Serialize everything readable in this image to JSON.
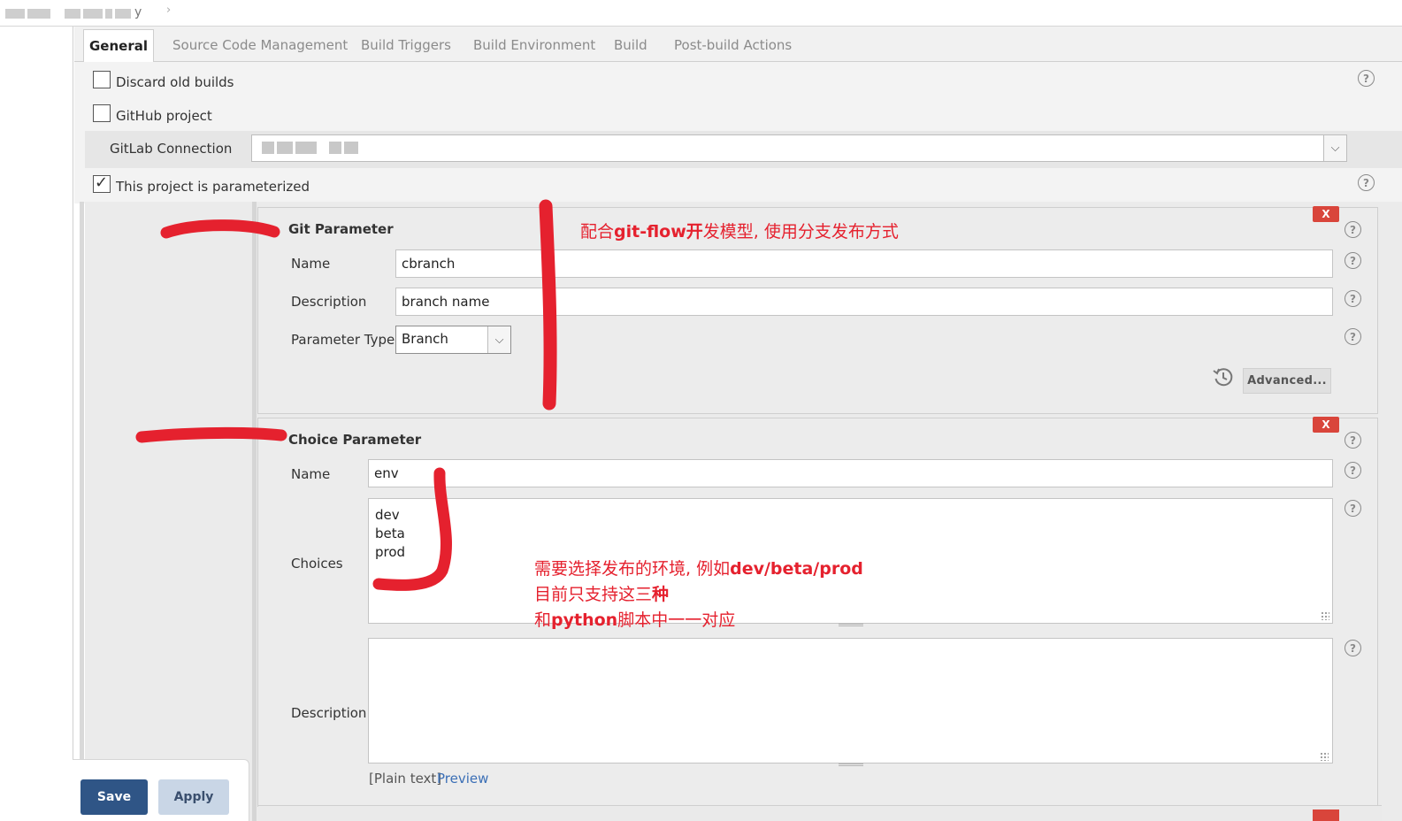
{
  "breadcrumb": {
    "tail_text": "y",
    "separator": "›"
  },
  "tabs": [
    {
      "label": "General",
      "active": true
    },
    {
      "label": "Source Code Management",
      "active": false
    },
    {
      "label": "Build Triggers",
      "active": false
    },
    {
      "label": "Build Environment",
      "active": false
    },
    {
      "label": "Build",
      "active": false
    },
    {
      "label": "Post-build Actions",
      "active": false
    }
  ],
  "general": {
    "discard_old_builds": {
      "label": "Discard old builds",
      "checked": false
    },
    "github_project": {
      "label": "GitHub project",
      "checked": false
    },
    "gitlab_connection": {
      "label": "GitLab Connection"
    },
    "parameterized": {
      "label": "This project is parameterized",
      "checked": true
    }
  },
  "git_parameter": {
    "title": "Git Parameter",
    "delete_label": "X",
    "name_label": "Name",
    "name_value": "cbranch",
    "description_label": "Description",
    "description_value": "branch name",
    "param_type_label": "Parameter Type",
    "param_type_value": "Branch",
    "advanced_label": "Advanced..."
  },
  "choice_parameter": {
    "title": "Choice Parameter",
    "delete_label": "X",
    "name_label": "Name",
    "name_value": "env",
    "choices_label": "Choices",
    "choices": [
      "dev",
      "beta",
      "prod"
    ],
    "description_label": "Description",
    "description_value": "",
    "plain_text_label": "[Plain text]",
    "preview_label": "Preview"
  },
  "help_glyph": "?",
  "dropdown_glyph": "⌵",
  "buttons": {
    "save": "Save",
    "apply": "Apply"
  },
  "annotations": {
    "note1_prefix": "配合",
    "note1_bold": "git-flow开",
    "note1_suffix": "发模型, 使用分支发布方式",
    "note2_prefix": "需要选择发布的环境, 例如",
    "note2_bold": "dev/beta/prod",
    "note3_prefix": "目前只支持这三",
    "note3_bold": "种",
    "note4_prefix": "和",
    "note4_bold": "python",
    "note4_suffix": "脚本中一一对应",
    "color": "#e5212e"
  },
  "colors": {
    "save_bg": "#2f5586",
    "apply_bg": "#c9d6e6",
    "delete_bg": "#d9453b",
    "link": "#3b6fb6"
  }
}
